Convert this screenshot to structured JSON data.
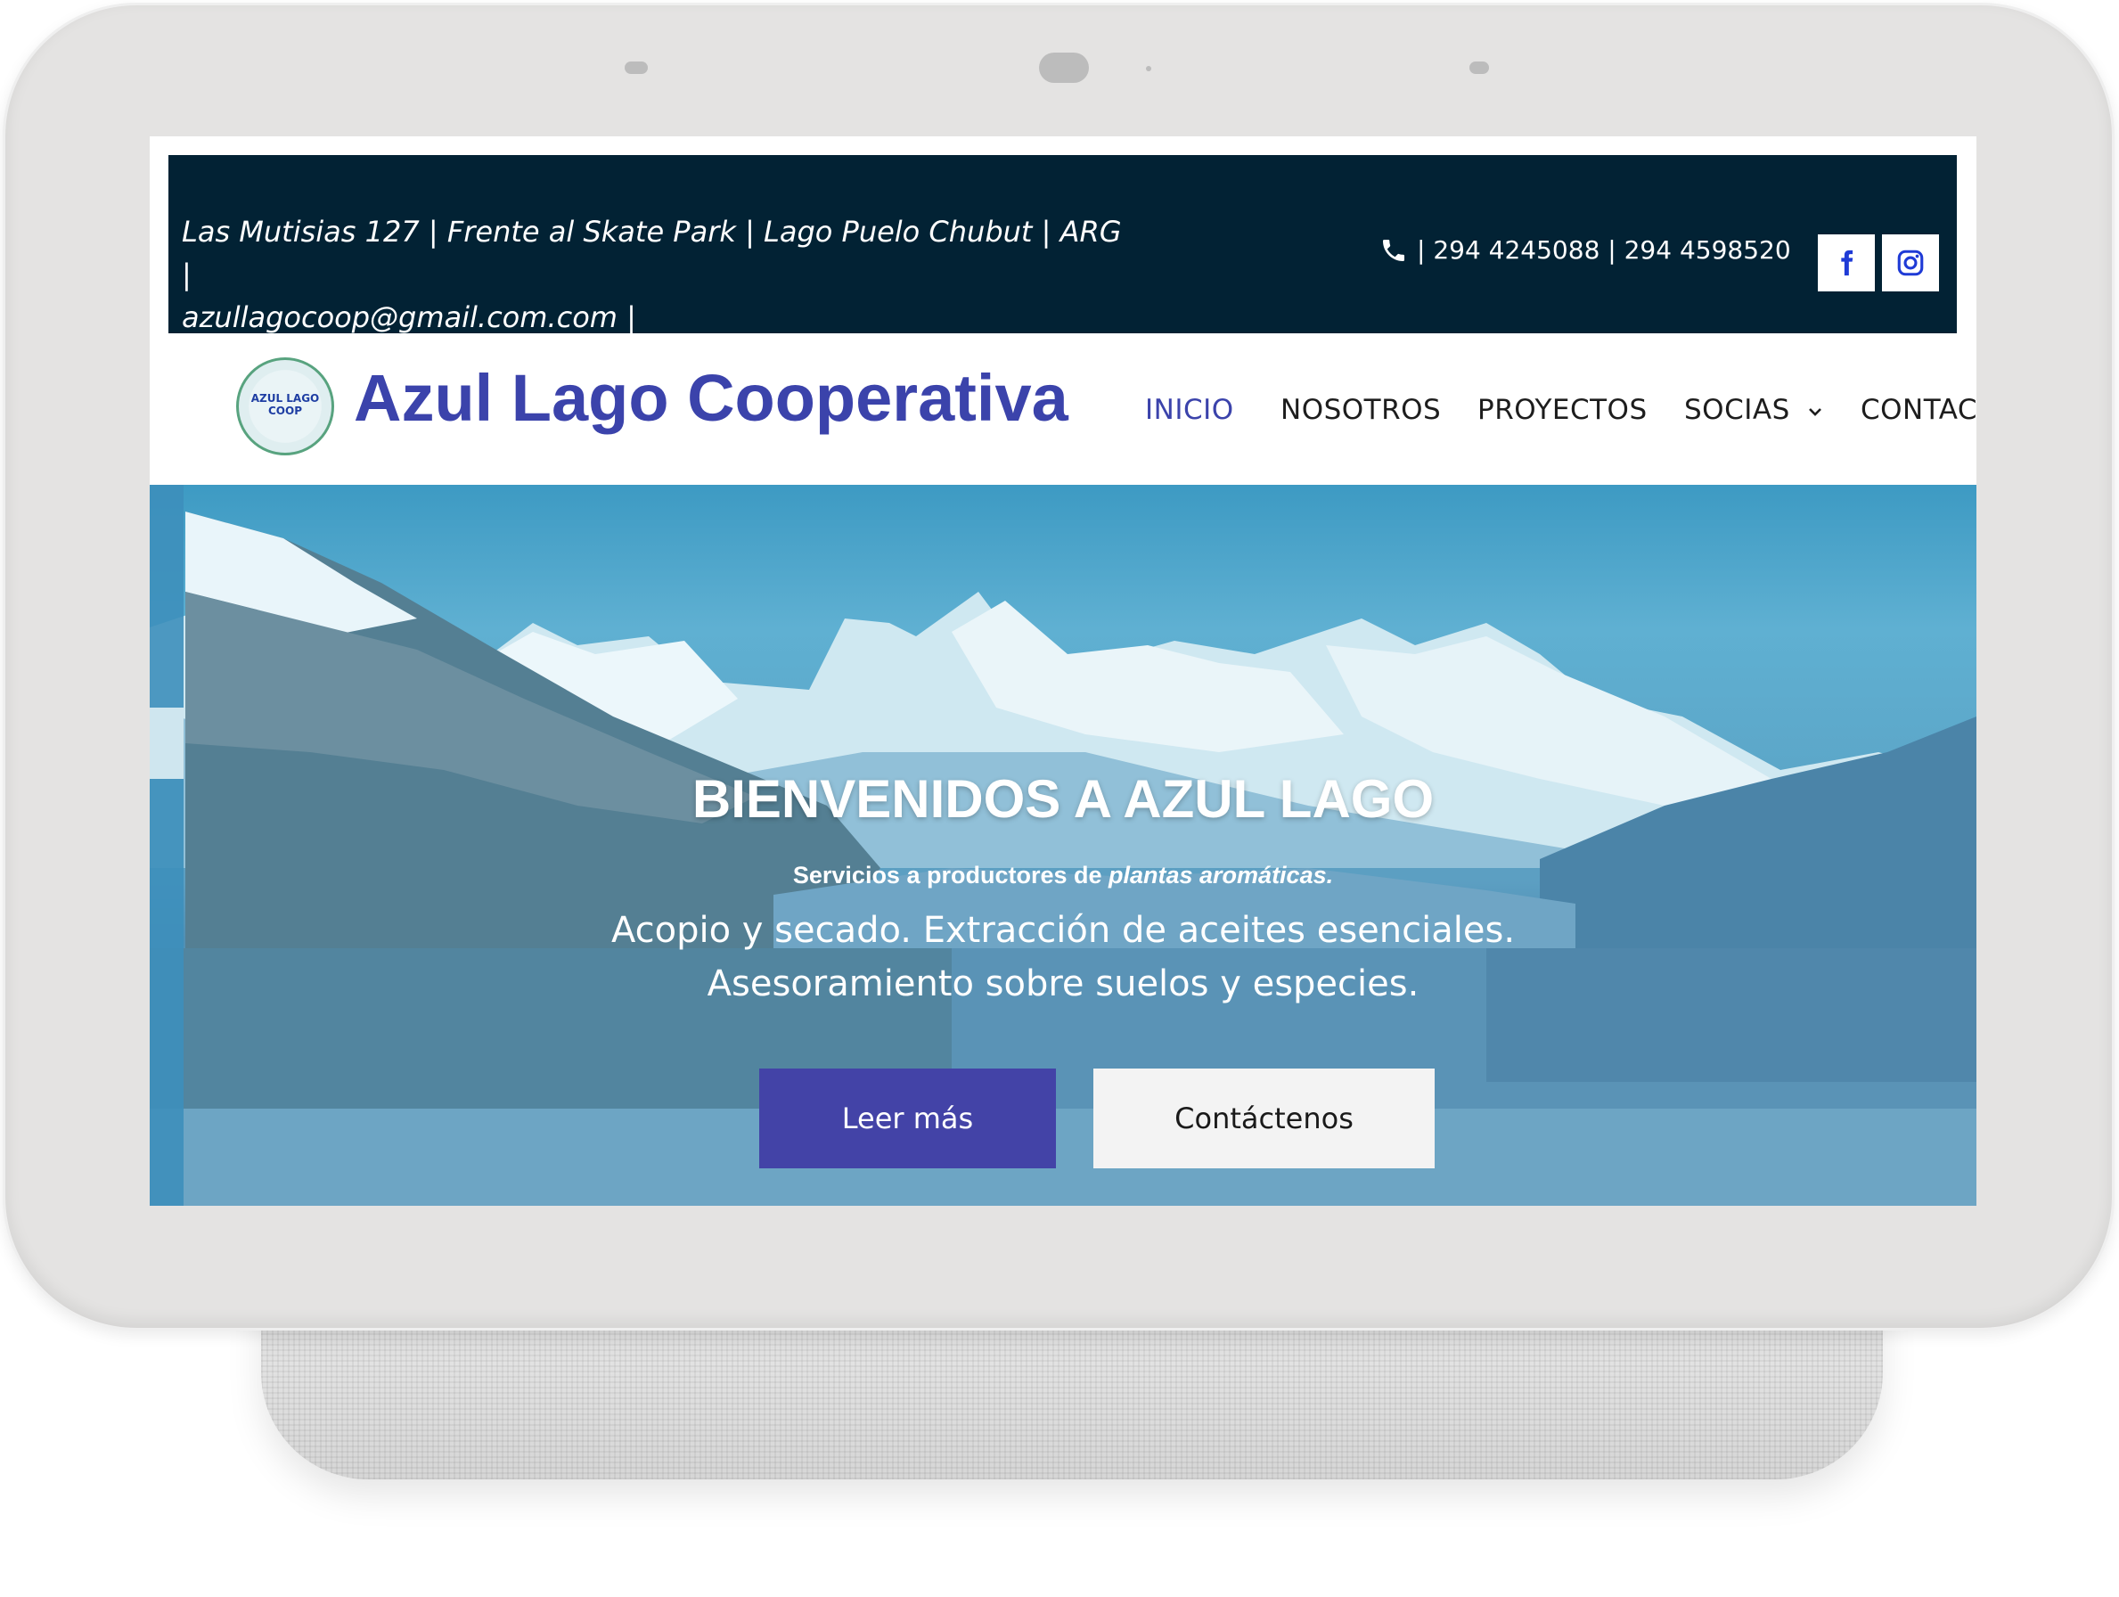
{
  "topbar": {
    "address_line1": "Las Mutisias 127 | Frente al Skate Park | Lago Puelo Chubut | ARG |",
    "address_line2": "azullagocoop@gmail.com.com |",
    "phones": "| 294 4245088 | 294 4598520"
  },
  "brand": {
    "name": "Azul Lago Cooperativa",
    "logo_text": "AZUL LAGO COOP"
  },
  "nav": {
    "items": [
      {
        "label": "INICIO",
        "active": true
      },
      {
        "label": "NOSOTROS"
      },
      {
        "label": "PROYECTOS"
      },
      {
        "label": "SOCIAS"
      },
      {
        "label": "CONTACT"
      }
    ]
  },
  "hero": {
    "title": "BIENVENIDOS A AZUL LAGO",
    "subtitle_prefix": "Servicios a productores de ",
    "subtitle_emphasis": "plantas aromáticas.",
    "description": "Acopio y secado. Extracción de aceites esenciales. Asesoramiento sobre suelos y especies.",
    "primary_button": "Leer más",
    "secondary_button": "Contáctenos"
  },
  "colors": {
    "topbar_bg": "#022234",
    "brand": "#3b43ab",
    "primary_button": "#4343a7",
    "secondary_button": "#f3f3f3"
  },
  "icons": [
    "phone-icon",
    "facebook-icon",
    "instagram-icon",
    "chevron-down-icon",
    "logo-image"
  ]
}
